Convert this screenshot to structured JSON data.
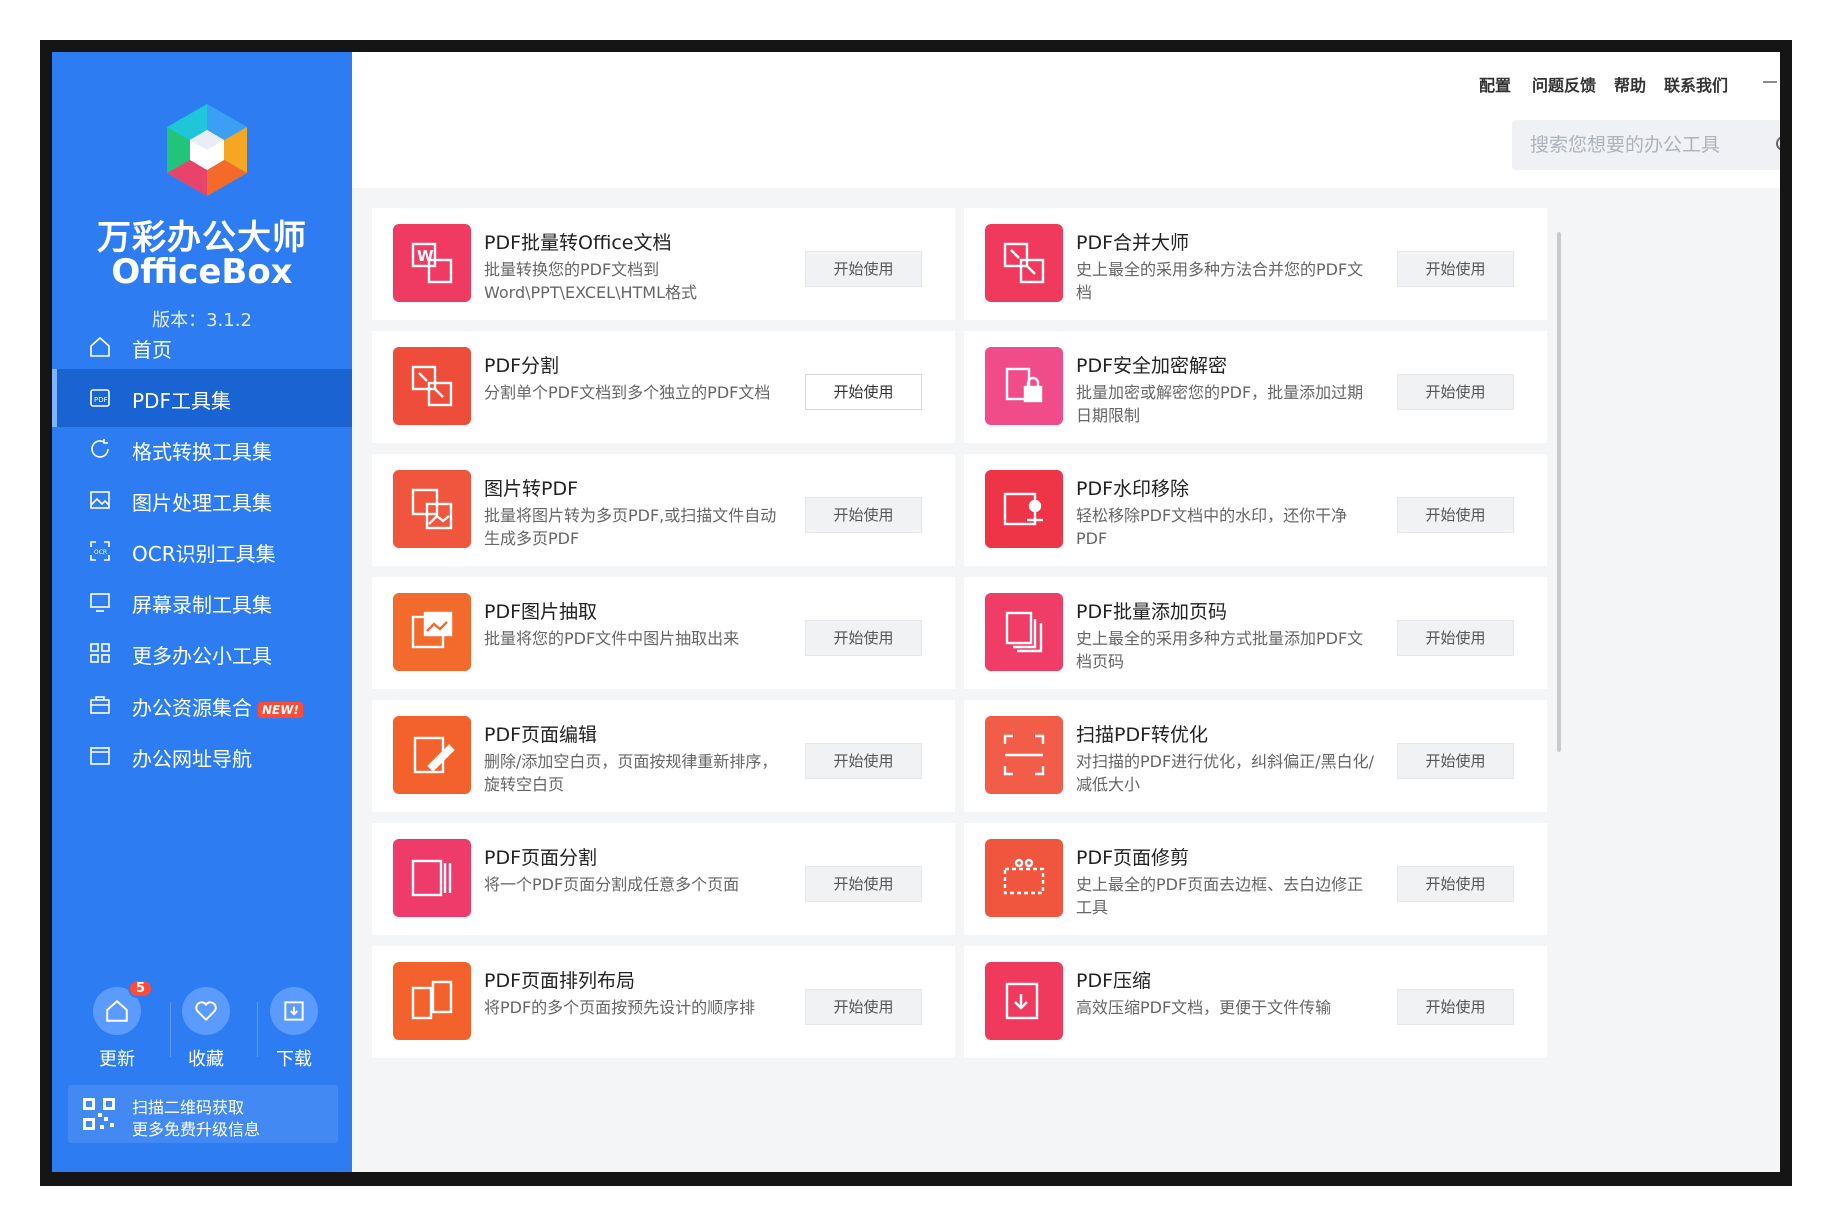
{
  "app": {
    "name_cn": "万彩办公大师",
    "name_en": "OfficeBox",
    "version": "版本：3.1.2"
  },
  "header": {
    "menu": [
      "配置",
      "问题反馈",
      "帮助",
      "联系我们"
    ],
    "search_placeholder": "搜索您想要的办公工具"
  },
  "sidebar": {
    "items": [
      {
        "label": "首页",
        "icon": "home-icon"
      },
      {
        "label": "PDF工具集",
        "icon": "pdf-icon",
        "active": true
      },
      {
        "label": "格式转换工具集",
        "icon": "convert-icon"
      },
      {
        "label": "图片处理工具集",
        "icon": "image-icon"
      },
      {
        "label": "OCR识别工具集",
        "icon": "ocr-icon"
      },
      {
        "label": "屏幕录制工具集",
        "icon": "screen-icon"
      },
      {
        "label": "更多办公小工具",
        "icon": "grid-icon"
      },
      {
        "label": "办公资源集合",
        "icon": "briefcase-icon",
        "badge": "NEW!"
      },
      {
        "label": "办公网址导航",
        "icon": "browser-icon"
      }
    ],
    "bottom": [
      {
        "label": "更新",
        "count": "5"
      },
      {
        "label": "收藏"
      },
      {
        "label": "下载"
      }
    ],
    "qr_line1": "扫描二维码获取",
    "qr_line2": "更多免费升级信息"
  },
  "button_label": "开始使用",
  "cards": [
    {
      "title": "PDF批量转Office文档",
      "desc": "批量转换您的PDF文档到Word\\PPT\\EXCEL\\HTML格式",
      "color": "#ef3a62"
    },
    {
      "title": "PDF合并大师",
      "desc": "史上最全的采用多种方法合并您的PDF文档",
      "color": "#ef3a5e"
    },
    {
      "title": "PDF分割",
      "desc": "分割单个PDF文档到多个独立的PDF文档",
      "color": "#ee4d3b"
    },
    {
      "title": "PDF安全加密解密",
      "desc": "批量加密或解密您的PDF，批量添加过期日期限制",
      "color": "#f04c8a"
    },
    {
      "title": "图片转PDF",
      "desc": "批量将图片转为多页PDF,或扫描文件自动生成多页PDF",
      "color": "#f0563d"
    },
    {
      "title": "PDF水印移除",
      "desc": "轻松移除PDF文档中的水印，还你干净PDF",
      "color": "#ee3547"
    },
    {
      "title": "PDF图片抽取",
      "desc": "批量将您的PDF文件中图片抽取出来",
      "color": "#f26a2c"
    },
    {
      "title": "PDF批量添加页码",
      "desc": "史上最全的采用多种方式批量添加PDF文档页码",
      "color": "#ef3d68"
    },
    {
      "title": "PDF页面编辑",
      "desc": "删除/添加空白页，页面按规律重新排序，旋转空白页",
      "color": "#f3622c"
    },
    {
      "title": "扫描PDF转优化",
      "desc": "对扫描的PDF进行优化，纠斜偏正/黑白化/减低大小",
      "color": "#f25d4a"
    },
    {
      "title": "PDF页面分割",
      "desc": "将一个PDF页面分割成任意多个页面",
      "color": "#ef3b6a"
    },
    {
      "title": "PDF页面修剪",
      "desc": "史上最全的PDF页面去边框、去白边修正工具",
      "color": "#f0563d"
    },
    {
      "title": "PDF页面排列布局",
      "desc": "将PDF的多个页面按预先设计的顺序排",
      "color": "#f3622c"
    },
    {
      "title": "PDF压缩",
      "desc": "高效压缩PDF文档，更便于文件传输",
      "color": "#ef3a5e"
    }
  ],
  "colors": {
    "sidebar": "#2e7cf2",
    "sidebar_active": "#1a63d3"
  }
}
